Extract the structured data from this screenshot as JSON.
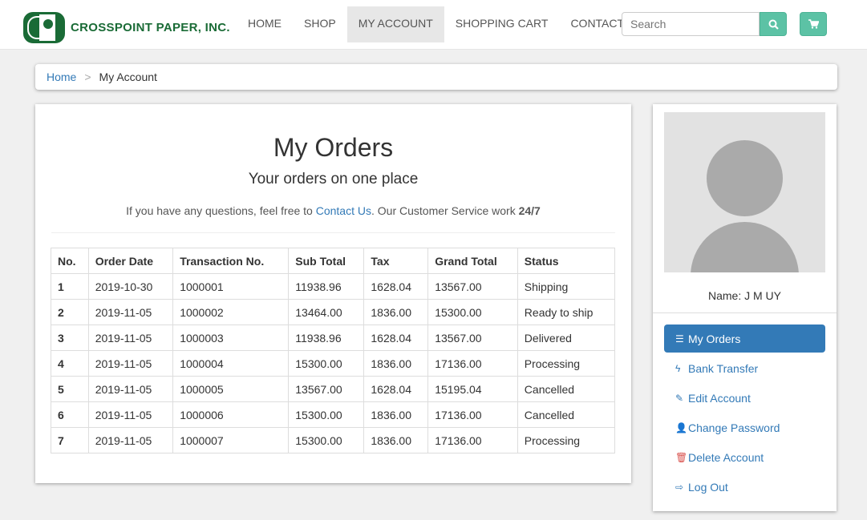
{
  "brand": {
    "name": "CROSSPOINT PAPER, INC."
  },
  "nav": {
    "items": [
      "HOME",
      "SHOP",
      "MY ACCOUNT",
      "SHOPPING CART",
      "CONTACT US"
    ],
    "active": 2
  },
  "search": {
    "placeholder": "Search",
    "value": ""
  },
  "breadcrumb": {
    "home": "Home",
    "sep": ">",
    "current": "My Account"
  },
  "orders": {
    "title": "My Orders",
    "subtitle": "Your orders on one place",
    "note_pre": "If you have any questions, feel free to ",
    "note_link": "Contact Us",
    "note_mid": ". Our Customer Service work ",
    "note_bold": "24/7",
    "columns": [
      "No.",
      "Order Date",
      "Transaction No.",
      "Sub Total",
      "Tax",
      "Grand Total",
      "Status"
    ],
    "rows": [
      [
        "1",
        "2019-10-30",
        "1000001",
        "11938.96",
        "1628.04",
        "13567.00",
        "Shipping"
      ],
      [
        "2",
        "2019-11-05",
        "1000002",
        "13464.00",
        "1836.00",
        "15300.00",
        "Ready to ship"
      ],
      [
        "3",
        "2019-11-05",
        "1000003",
        "11938.96",
        "1628.04",
        "13567.00",
        "Delivered"
      ],
      [
        "4",
        "2019-11-05",
        "1000004",
        "15300.00",
        "1836.00",
        "17136.00",
        "Processing"
      ],
      [
        "5",
        "2019-11-05",
        "1000005",
        "13567.00",
        "1628.04",
        "15195.04",
        "Cancelled"
      ],
      [
        "6",
        "2019-11-05",
        "1000006",
        "15300.00",
        "1836.00",
        "17136.00",
        "Cancelled"
      ],
      [
        "7",
        "2019-11-05",
        "1000007",
        "15300.00",
        "1836.00",
        "17136.00",
        "Processing"
      ]
    ]
  },
  "profile": {
    "name": "Name: J M UY",
    "links": [
      {
        "label": "My Orders",
        "icon": "list-icon",
        "glyph": "☰",
        "active": true
      },
      {
        "label": "Bank Transfer",
        "icon": "bolt-icon",
        "glyph": "ϟ"
      },
      {
        "label": "Edit Account",
        "icon": "pencil-icon",
        "glyph": "✎"
      },
      {
        "label": "Change Password",
        "icon": "user-icon",
        "glyph": "👤"
      },
      {
        "label": "Delete Account",
        "icon": "trash-icon",
        "glyph": "🗑"
      },
      {
        "label": "Log Out",
        "icon": "logout-icon",
        "glyph": "⇨"
      }
    ]
  },
  "colors": {
    "brand": "#1a6b36",
    "accent": "#5cc2a5",
    "link": "#337ab7"
  }
}
